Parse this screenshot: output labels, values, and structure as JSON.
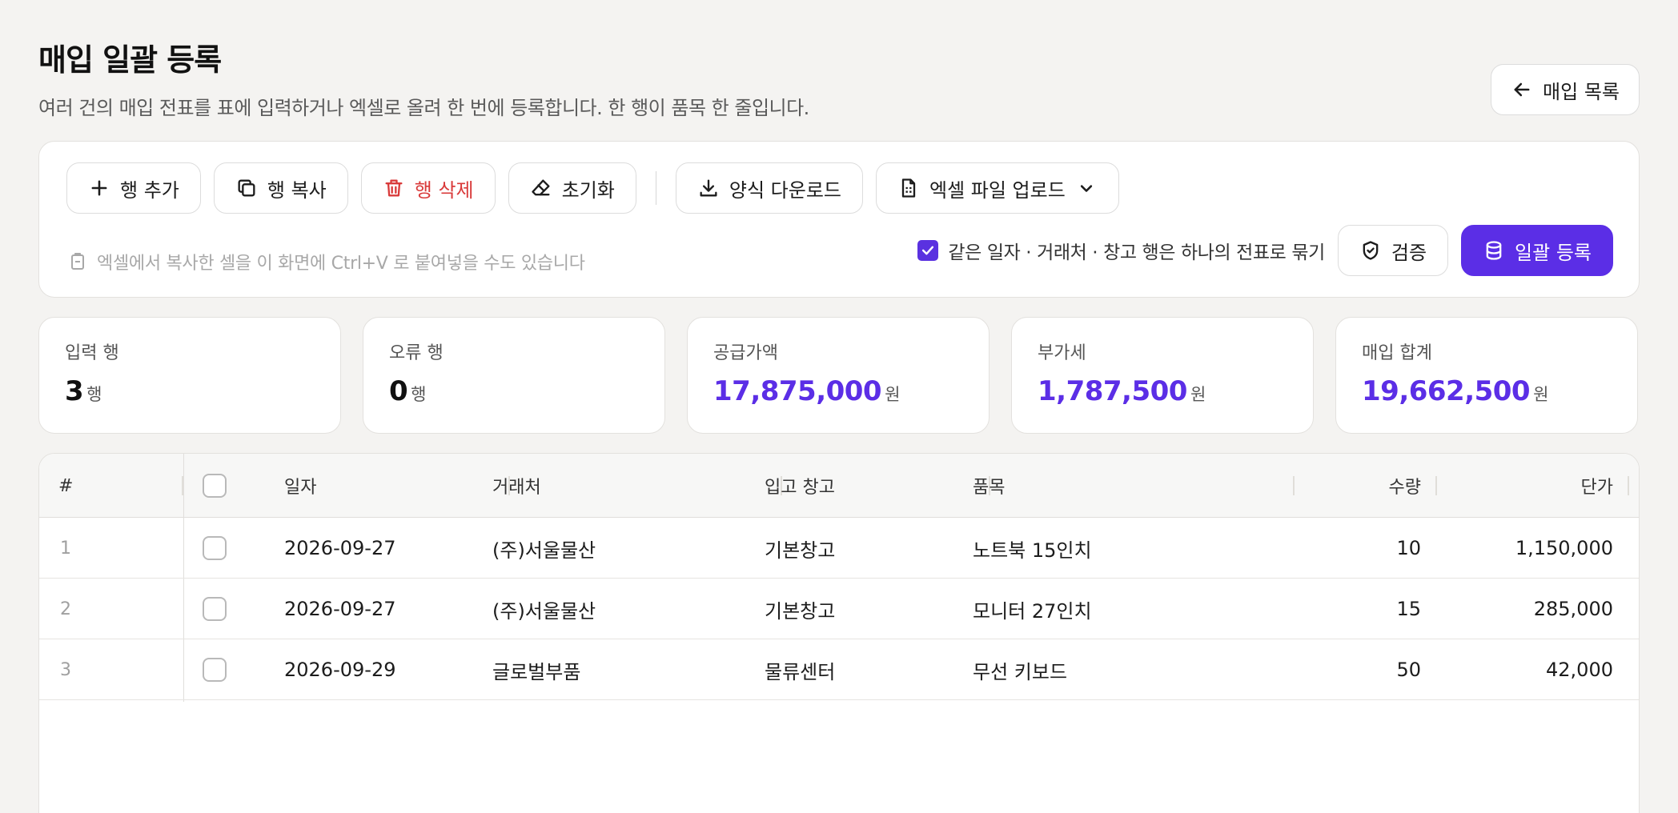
{
  "header": {
    "title": "매입 일괄 등록",
    "subtitle": "여러 건의 매입 전표를 표에 입력하거나 엑셀로 올려 한 번에 등록합니다. 한 행이 품목 한 줄입니다.",
    "back_label": "매입 목록"
  },
  "toolbar": {
    "add_row": "행 추가",
    "copy_row": "행 복사",
    "delete_row": "행 삭제",
    "reset": "초기화",
    "download_template": "양식 다운로드",
    "upload_excel": "엑셀 파일 업로드",
    "paste_hint": "엑셀에서 복사한 셀을 이 화면에 Ctrl+V 로 붙여넣을 수도 있습니다",
    "group_option": "같은 일자 · 거래처 · 창고 행은 하나의 전표로 묶기",
    "group_checked": true,
    "validate": "검증",
    "submit": "일괄 등록"
  },
  "stats": [
    {
      "label": "입력 행",
      "value": "3",
      "unit": "행"
    },
    {
      "label": "오류 행",
      "value": "0",
      "unit": "행"
    },
    {
      "label": "공급가액",
      "value": "17,875,000",
      "unit": "원"
    },
    {
      "label": "부가세",
      "value": "1,787,500",
      "unit": "원"
    },
    {
      "label": "매입 합계",
      "value": "19,662,500",
      "unit": "원"
    }
  ],
  "table": {
    "columns": [
      "#",
      "일자",
      "거래처",
      "입고 창고",
      "품목",
      "수량",
      "단가"
    ],
    "rows": [
      {
        "num": "1",
        "date": "2026-09-27",
        "vendor": "(주)서울물산",
        "warehouse": "기본창고",
        "item": "노트북 15인치",
        "qty": "10",
        "price": "1,150,000"
      },
      {
        "num": "2",
        "date": "2026-09-27",
        "vendor": "(주)서울물산",
        "warehouse": "기본창고",
        "item": "모니터 27인치",
        "qty": "15",
        "price": "285,000"
      },
      {
        "num": "3",
        "date": "2026-09-29",
        "vendor": "글로벌부품",
        "warehouse": "물류센터",
        "item": "무선 키보드",
        "qty": "50",
        "price": "42,000"
      }
    ]
  },
  "colors": {
    "accent": "#5b2ee6",
    "danger": "#d93a3a",
    "background": "#f4f3f1"
  }
}
